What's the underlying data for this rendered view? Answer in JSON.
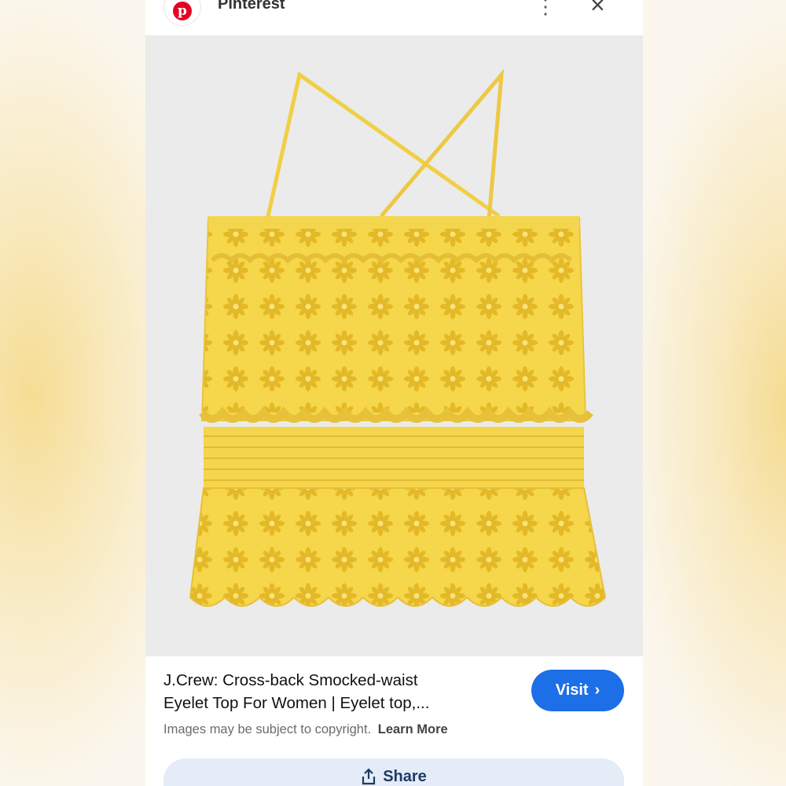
{
  "app": {
    "name": "Pinterest"
  },
  "colors": {
    "accent": "#1c6fe6",
    "brand": "#e60023",
    "garment": "#f7dc4a"
  },
  "icons": {
    "logo": "pinterest-logo-icon",
    "more": "more-vertical-icon",
    "close": "close-icon",
    "visit": "chevron-right-icon",
    "share": "share-icon"
  },
  "pin": {
    "title_line1": "J.Crew: Cross-back Smocked-waist",
    "title_line2": "Eyelet Top For Women | Eyelet top,...",
    "copyright": "Images may be subject to copyright.",
    "learn_more": "Learn More"
  },
  "actions": {
    "visit": "Visit",
    "share": "Share"
  }
}
